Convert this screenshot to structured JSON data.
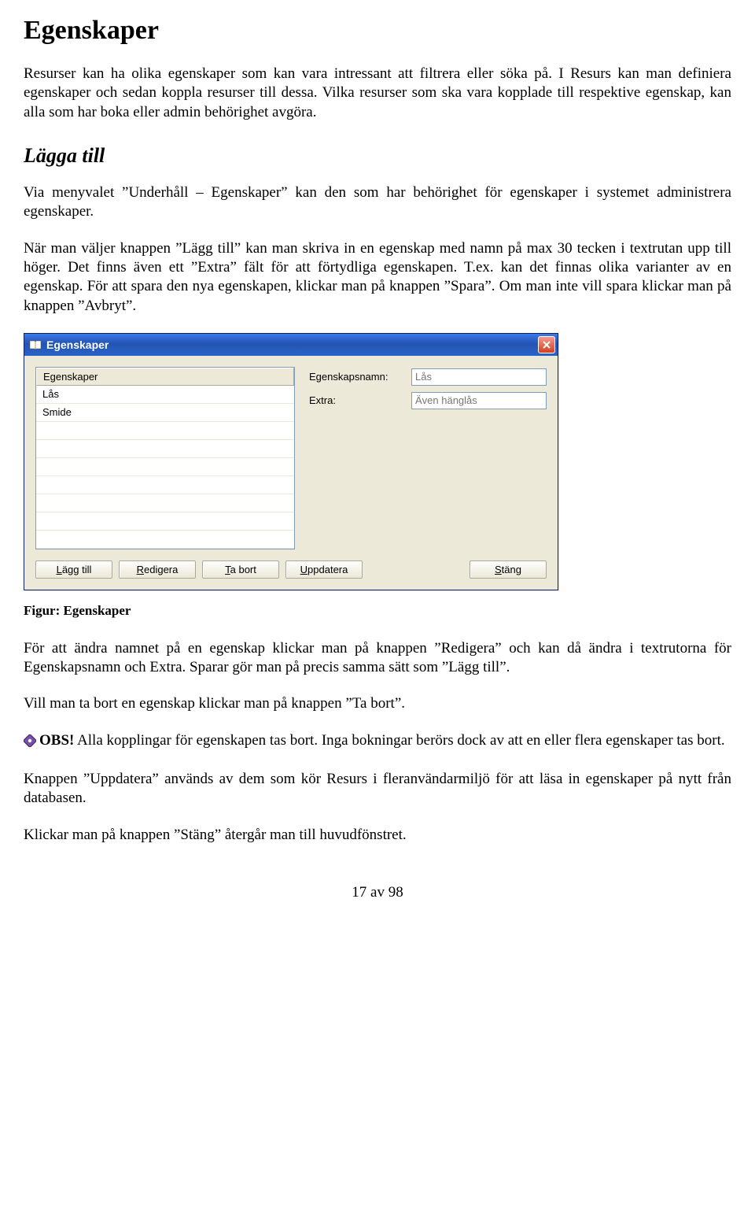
{
  "h1": "Egenskaper",
  "para1_a": "Resurser kan ha olika egenskaper som kan vara intressant att filtrera eller söka på. I Resurs kan man definiera egenskaper och sedan koppla resurser till dessa. Vilka resurser som ska vara kopplade till respektive egenskap, kan alla som har boka eller admin behörighet avgöra.",
  "h2": "Lägga till",
  "para2": "Via menyvalet ”Underhåll – Egenskaper” kan den som har behörighet för egenskaper i systemet administrera egenskaper.",
  "para3": "När man väljer knappen ”Lägg till” kan man skriva in en egenskap med namn på max 30 tecken i textrutan upp till höger. Det finns även ett ”Extra” fält för att förtydliga egenskapen. T.ex. kan det finnas olika varianter av en egenskap. För att spara den nya egenskapen, klickar man på knappen ”Spara”. Om man inte vill spara klickar man på knappen ”Avbryt”.",
  "dialog": {
    "title": "Egenskaper",
    "list_header": "Egenskaper",
    "items": [
      "Lås",
      "Smide",
      "",
      "",
      "",
      "",
      "",
      "",
      ""
    ],
    "label_name": "Egenskapsnamn:",
    "label_extra": "Extra:",
    "value_name": "Lås",
    "value_extra": "Även hänglås",
    "btn_add": "Lägg till",
    "btn_add_u": "L",
    "btn_edit": "Redigera",
    "btn_edit_u": "R",
    "btn_del": "Ta bort",
    "btn_del_u": "T",
    "btn_upd": "Uppdatera",
    "btn_upd_u": "U",
    "btn_close": "Stäng",
    "btn_close_u": "S"
  },
  "caption": "Figur: Egenskaper",
  "para4": "För att ändra namnet på en egenskap klickar man på knappen ”Redigera” och kan då ändra i textrutorna för Egenskapsnamn och Extra. Sparar gör man på precis samma sätt som ”Lägg till”.",
  "para5": "Vill man ta bort en egenskap klickar man på knappen ”Ta bort”.",
  "obs_label": "OBS!",
  "para6_rest": " Alla kopplingar för egenskapen tas bort. Inga bokningar berörs dock av att en eller flera egenskaper tas bort.",
  "para7": "Knappen ”Uppdatera” används av dem som kör Resurs i fleranvändarmiljö för att läsa in egenskaper på nytt från databasen.",
  "para8": "Klickar man på knappen ”Stäng” återgår man till huvudfönstret.",
  "footer": "17 av 98"
}
